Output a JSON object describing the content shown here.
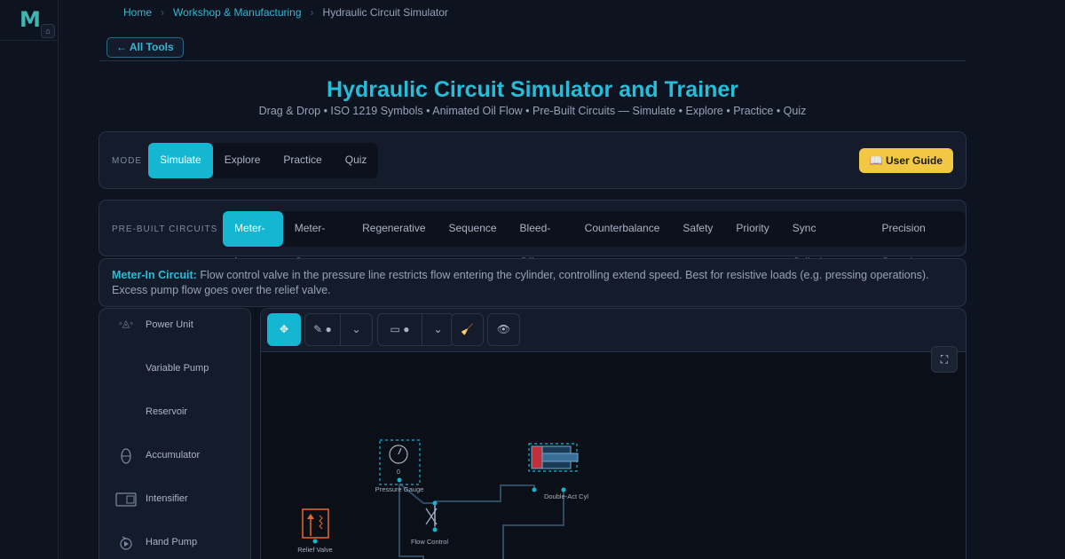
{
  "app": {
    "logo_letter": "M"
  },
  "breadcrumb": [
    "Home",
    "Workshop & Manufacturing",
    "Hydraulic Circuit Simulator"
  ],
  "back_label": "← All Tools",
  "header": {
    "title": "Hydraulic Circuit Simulator and Trainer",
    "subtitle": "Drag & Drop • ISO 1219 Symbols • Animated Oil Flow • Pre-Built Circuits — Simulate • Explore • Practice • Quiz"
  },
  "mode": {
    "label": "MODE",
    "options": [
      "Simulate",
      "Explore",
      "Practice",
      "Quiz"
    ],
    "active": "Simulate",
    "guide_label": "📖 User Guide"
  },
  "circuits": {
    "label": "PRE-BUILT CIRCUITS",
    "options": [
      "Meter-In",
      "Meter-Out",
      "Regenerative",
      "Sequence",
      "Bleed-Off",
      "Counterbalance",
      "Safety",
      "Priority",
      "Sync Cylinders",
      "Precision Speed"
    ],
    "active": "Meter-In"
  },
  "description": {
    "title": "Meter-In Circuit:",
    "text": "Flow control valve in the pressure line restricts flow entering the cylinder, controlling extend speed. Best for resistive loads (e.g. pressing operations). Excess pump flow goes over the relief valve."
  },
  "palette": [
    {
      "label": "Power Unit",
      "icon": "power-unit-icon"
    },
    {
      "label": "Variable Pump",
      "icon": "variable-pump-icon"
    },
    {
      "label": "Reservoir",
      "icon": "reservoir-icon"
    },
    {
      "label": "Accumulator",
      "icon": "accumulator-icon"
    },
    {
      "label": "Intensifier",
      "icon": "intensifier-icon"
    },
    {
      "label": "Hand Pump",
      "icon": "hand-pump-icon"
    }
  ],
  "toolbar": {
    "move": "✥",
    "pen": "✎ ●",
    "dropdown": "⌄",
    "shape": "▭ ●",
    "eraser": "🧹",
    "eye": "👁",
    "fullscreen": "⛶"
  },
  "canvas": {
    "gauge_value": "0",
    "labels": {
      "gauge": "Pressure Gauge",
      "cylinder": "Double-Act Cyl",
      "flow_control": "Flow Control",
      "relief": "Relief Valve"
    }
  },
  "colors": {
    "accent": "#14b6d1",
    "guide": "#f2c744",
    "relief": "#e8692a",
    "cylinder_cap": "#c0303a"
  }
}
